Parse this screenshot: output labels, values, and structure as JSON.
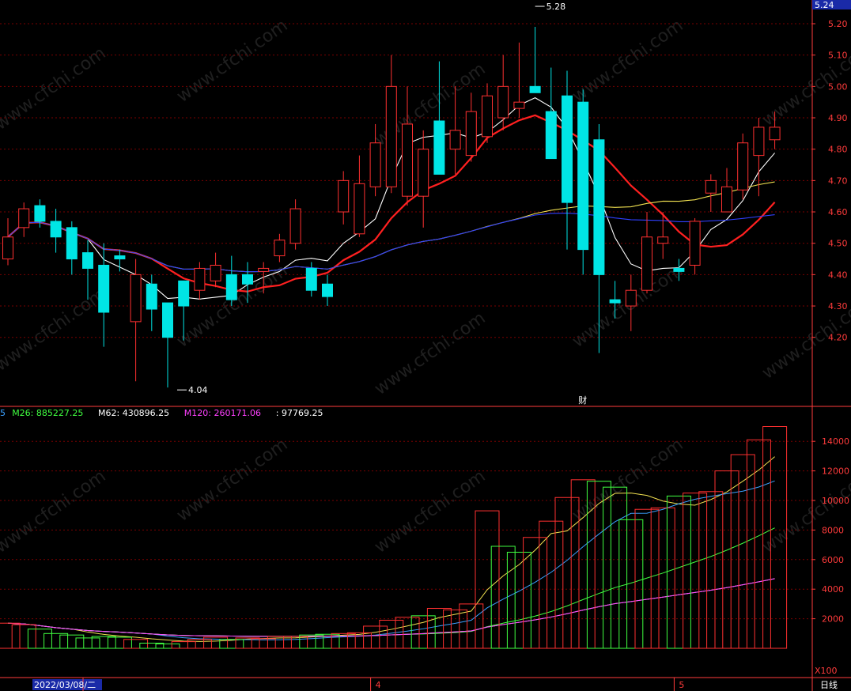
{
  "chart_data": [
    {
      "type": "candlestick",
      "name": "price-panel",
      "x": [
        "2022-03-01",
        "2022-03-02",
        "2022-03-03",
        "2022-03-04",
        "2022-03-07",
        "2022-03-08",
        "2022-03-09",
        "2022-03-10",
        "2022-03-11",
        "2022-03-14",
        "2022-03-15",
        "2022-03-16",
        "2022-03-17",
        "2022-03-18",
        "2022-03-21",
        "2022-03-22",
        "2022-03-23",
        "2022-03-24",
        "2022-03-25",
        "2022-03-28",
        "2022-03-29",
        "2022-03-30",
        "2022-03-31",
        "2022-04-01",
        "2022-04-06",
        "2022-04-07",
        "2022-04-08",
        "2022-04-11",
        "2022-04-12",
        "2022-04-13",
        "2022-04-14",
        "2022-04-15",
        "2022-04-18",
        "2022-04-19",
        "2022-04-20",
        "2022-04-21",
        "2022-04-22",
        "2022-04-25",
        "2022-04-26",
        "2022-04-27",
        "2022-04-28",
        "2022-04-29",
        "2022-05-05",
        "2022-05-06",
        "2022-05-09",
        "2022-05-10",
        "2022-05-11",
        "2022-05-12",
        "2022-05-13"
      ],
      "open": [
        4.45,
        4.55,
        4.62,
        4.57,
        4.55,
        4.47,
        4.43,
        4.46,
        4.25,
        4.37,
        4.31,
        4.38,
        4.35,
        4.38,
        4.4,
        4.4,
        4.41,
        4.46,
        4.5,
        4.42,
        4.37,
        4.6,
        4.53,
        4.68,
        4.68,
        4.65,
        4.65,
        4.89,
        4.8,
        4.78,
        4.84,
        4.9,
        4.93,
        5.0,
        4.92,
        4.97,
        4.95,
        4.83,
        4.32,
        4.3,
        4.35,
        4.5,
        4.42,
        4.43,
        4.66,
        4.6,
        4.67,
        4.78,
        4.83
      ],
      "close": [
        4.52,
        4.61,
        4.57,
        4.52,
        4.45,
        4.42,
        4.28,
        4.45,
        4.4,
        4.29,
        4.2,
        4.3,
        4.42,
        4.43,
        4.32,
        4.37,
        4.42,
        4.51,
        4.61,
        4.35,
        4.33,
        4.7,
        4.69,
        4.82,
        5.0,
        4.88,
        4.8,
        4.72,
        4.86,
        4.92,
        4.97,
        5.0,
        4.95,
        4.98,
        4.77,
        4.63,
        4.48,
        4.4,
        4.31,
        4.35,
        4.52,
        4.52,
        4.41,
        4.57,
        4.7,
        4.68,
        4.82,
        4.87,
        4.87
      ],
      "high": [
        4.58,
        4.63,
        4.64,
        4.61,
        4.57,
        4.51,
        4.5,
        4.48,
        4.45,
        4.4,
        4.31,
        4.32,
        4.44,
        4.47,
        4.46,
        4.44,
        4.44,
        4.53,
        4.64,
        4.44,
        4.4,
        4.73,
        4.78,
        4.88,
        5.1,
        5.0,
        4.86,
        5.08,
        5.0,
        4.98,
        5.01,
        5.1,
        5.14,
        5.19,
        5.06,
        5.05,
        4.99,
        4.88,
        4.38,
        4.4,
        4.6,
        4.6,
        4.45,
        4.58,
        4.72,
        4.74,
        4.85,
        4.9,
        4.92
      ],
      "low": [
        4.43,
        4.52,
        4.55,
        4.47,
        4.4,
        4.32,
        4.17,
        4.41,
        4.06,
        4.22,
        4.04,
        4.19,
        4.32,
        4.36,
        4.3,
        4.31,
        4.34,
        4.44,
        4.48,
        4.33,
        4.3,
        4.56,
        4.52,
        4.65,
        4.66,
        4.62,
        4.55,
        4.77,
        4.72,
        4.76,
        4.82,
        4.86,
        4.9,
        4.98,
        4.8,
        4.48,
        4.4,
        4.15,
        4.26,
        4.22,
        4.34,
        4.45,
        4.38,
        4.4,
        4.6,
        4.6,
        4.64,
        4.65,
        4.8
      ],
      "annotations": [
        {
          "text": "5.28",
          "type": "high"
        },
        {
          "text": "4.04",
          "type": "low"
        },
        {
          "text": "财",
          "type": "event"
        }
      ],
      "moving_averages": [
        {
          "name": "MA5",
          "color": "#ffffff"
        },
        {
          "name": "MA10",
          "color": "#ff2020"
        },
        {
          "name": "MA30",
          "color": "#f0e050"
        },
        {
          "name": "MA60",
          "color": "#3040ff"
        }
      ],
      "y_ticks": [
        "5.20",
        "5.10",
        "5.00",
        "4.90",
        "4.80",
        "4.70",
        "4.60",
        "4.50",
        "4.40",
        "4.30",
        "4.20"
      ],
      "current_price_label": "5.24",
      "ylim": [
        4.0,
        5.28
      ]
    },
    {
      "type": "volume-bars",
      "name": "volume-panel",
      "values": [
        1700,
        1600,
        1300,
        1000,
        900,
        700,
        800,
        750,
        600,
        350,
        300,
        450,
        600,
        750,
        600,
        700,
        650,
        800,
        800,
        900,
        950,
        1000,
        1050,
        1500,
        1900,
        2100,
        2200,
        2700,
        2600,
        3000,
        9300,
        6900,
        6500,
        7500,
        8600,
        10200,
        11400,
        11300,
        10900,
        8700,
        9400,
        9500,
        10300,
        10500,
        10600,
        12000,
        13100,
        14100,
        15000
      ],
      "rising": [
        true,
        true,
        false,
        false,
        false,
        false,
        false,
        false,
        true,
        false,
        false,
        true,
        true,
        true,
        false,
        true,
        true,
        true,
        true,
        false,
        false,
        true,
        true,
        true,
        true,
        true,
        false,
        true,
        true,
        true,
        true,
        false,
        false,
        true,
        true,
        true,
        true,
        false,
        false,
        false,
        true,
        true,
        false,
        true,
        true,
        true,
        true,
        true,
        true
      ],
      "legend": [
        {
          "label": "5",
          "color": "#3aa0ff"
        },
        {
          "label": "M26: 885227.25",
          "color": "#40ff40"
        },
        {
          "label": "M62: 430896.25",
          "color": "#ffffff"
        },
        {
          "label": "M120: 260171.06",
          "color": "#ff40ff"
        },
        {
          "label": ": 97769.25",
          "color": "#ffffff"
        }
      ],
      "y_ticks": [
        "14000",
        "12000",
        "10000",
        "8000",
        "6000",
        "4000",
        "2000"
      ],
      "unit_label": "X100",
      "ylim": [
        0,
        16000
      ]
    }
  ],
  "x_axis": {
    "labels": [
      {
        "text": "2022/03/08/二",
        "index": 5,
        "highlight": true
      },
      {
        "text": "4",
        "index": 23
      },
      {
        "text": "5",
        "index": 42
      }
    ],
    "period_label": "日线"
  },
  "watermark": "www.cfchi.com",
  "colors": {
    "up": "#ff3030",
    "down": "#00e5e5",
    "axis": "#ff3b3b",
    "grid": "#7a0000",
    "bg": "#000000"
  }
}
